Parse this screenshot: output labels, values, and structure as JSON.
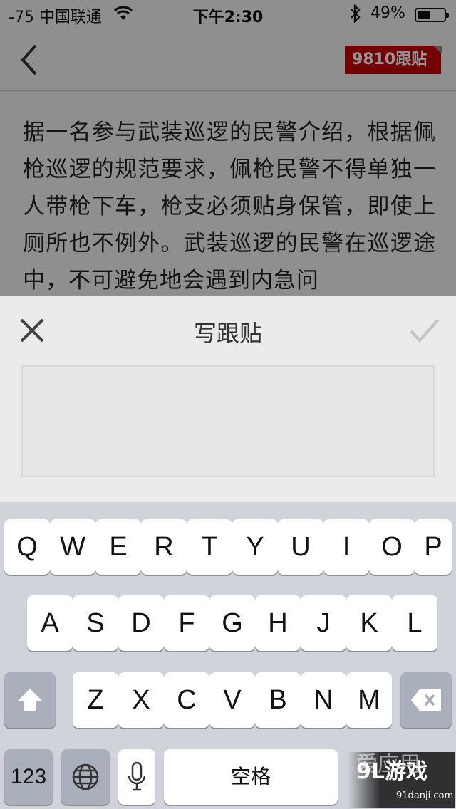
{
  "status_bar": {
    "carrier": "-75 中国联通",
    "time": "下午2:30",
    "battery_pct": "49%",
    "battery_level": 0.49,
    "icons": [
      "wifi-icon",
      "bluetooth-icon",
      "battery-icon"
    ]
  },
  "nav": {
    "back_icon": "chevron-left-icon",
    "comments_badge": "9810跟贴",
    "badge_color": "#c8000a"
  },
  "article": {
    "text": "据一名参与武装巡逻的民警介绍，根据佩枪巡逻的规范要求，佩枪民警不得单独一人带枪下车，枪支必须贴身保管，即使上厕所也不例外。武装巡逻的民警在巡逻途中，不可避免地会遇到内急问"
  },
  "compose": {
    "title": "写跟贴",
    "close_icon": "close-icon",
    "submit_icon": "check-icon",
    "input_value": "",
    "input_placeholder": ""
  },
  "keyboard": {
    "row1": [
      "Q",
      "W",
      "E",
      "R",
      "T",
      "Y",
      "U",
      "I",
      "O",
      "P"
    ],
    "row2": [
      "A",
      "S",
      "D",
      "F",
      "G",
      "H",
      "J",
      "K",
      "L"
    ],
    "row3": [
      "Z",
      "X",
      "C",
      "V",
      "B",
      "N",
      "M"
    ],
    "key_123": "123",
    "key_space": "空格",
    "icons": [
      "shift-icon",
      "backspace-icon",
      "globe-icon",
      "microphone-icon"
    ]
  },
  "watermark": {
    "ghost": "爱应用",
    "brand": "9L游戏",
    "url": "91danji.com"
  }
}
